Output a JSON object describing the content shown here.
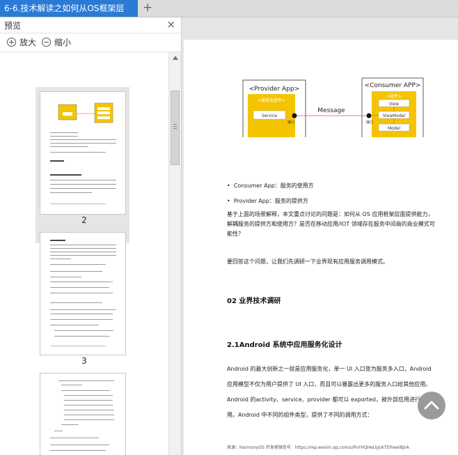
{
  "tab": {
    "title": "6-6.技术解读之如何从OS框架层",
    "plus": "+"
  },
  "preview": {
    "title": "预览",
    "close": "×",
    "zoom_in": "放大",
    "zoom_out": "缩小"
  },
  "thumbnails": [
    {
      "number": "2"
    },
    {
      "number": "3"
    }
  ],
  "diagram": {
    "provider_title": "<Provider App>",
    "provider_component": "<服务化组件>",
    "service_label": "Service",
    "message_label": "Message",
    "consumer_title": "<Consumer APP>",
    "consumer_component": "<组件>",
    "view_label": "View",
    "viewmodel_label": "ViewModel",
    "model_label": "Model",
    "port_label": "接口",
    "accent_color": "#f5c400",
    "link_color": "#e05050"
  },
  "document": {
    "bullet1": "Consumer App：服务的使用方",
    "bullet2": "Provider App：服务的提供方",
    "para1": "基于上面的场景解释，本文重点讨论的问题是：如何从 OS 应用框架层面提供能力，解耦服务的提供方和使用方？是否在移动应用/IOT 领域存在服务中间商的商业模式可能性？",
    "para2": "要回答这个问题，让我们先调研一下业界现有应用服务调用模式。",
    "heading1": "02 业界技术调研",
    "heading2": "2.1Android 系统中应用服务化设计",
    "para3": "Android 的最大创新之一就是应用服务化，单一 UI 入口变为服务多入口，Android 应用模型不仅为用户提供了 UI 入口，而且可以暴露出更多的服务入口给其他应用。Android 的activity、service、provider 都可以 exported，被外部应用进行调用。Android 中不同的组件类型，提供了不同的调用方式：",
    "source": "来源：HarmonyOS 开发者微信号　https://mp.weixin.qq.com/s/PoYHQHeUgUkTEIhwelBJrA"
  }
}
